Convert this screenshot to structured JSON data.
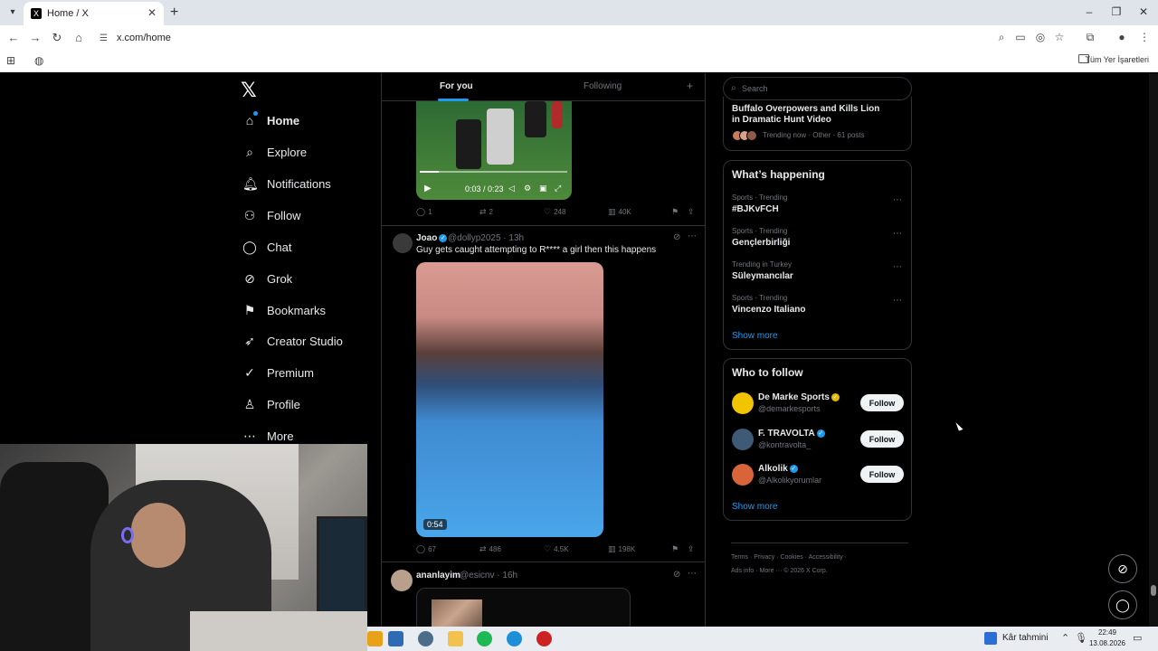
{
  "browser": {
    "tab_title": "Home / X",
    "tab_favicon": "X",
    "url": "x.com/home",
    "bookmarks_label": "Tüm Yer İşaretleri"
  },
  "logo": "𝕏",
  "nav": [
    {
      "label": "Home",
      "icon": "home-icon",
      "glyph": "⌂"
    },
    {
      "label": "Explore",
      "icon": "search-icon",
      "glyph": "⌕"
    },
    {
      "label": "Notifications",
      "icon": "bell-icon",
      "glyph": "🔔︎"
    },
    {
      "label": "Follow",
      "icon": "person-add-icon",
      "glyph": "⚇"
    },
    {
      "label": "Chat",
      "icon": "chat-icon",
      "glyph": "◯"
    },
    {
      "label": "Grok",
      "icon": "grok-icon",
      "glyph": "⊘"
    },
    {
      "label": "Bookmarks",
      "icon": "bookmark-icon",
      "glyph": "⚑"
    },
    {
      "label": "Creator Studio",
      "icon": "rocket-icon",
      "glyph": "➶"
    },
    {
      "label": "Premium",
      "icon": "verified-icon",
      "glyph": "✓"
    },
    {
      "label": "Profile",
      "icon": "person-icon",
      "glyph": "♙"
    },
    {
      "label": "More",
      "icon": "more-circle-icon",
      "glyph": "⋯"
    }
  ],
  "feed": {
    "tabs": [
      "For you",
      "Following"
    ],
    "post1": {
      "video_time": "0:03 / 0:23",
      "video_progress": 0.13,
      "replies": "1",
      "reposts": "2",
      "likes": "248",
      "views": "40K"
    },
    "post2": {
      "name": "Joao",
      "handle": "@dollyp2025 · 13h",
      "text": "Guy gets caught attempting to R**** a girl then this happens",
      "duration": "0:54",
      "replies": "67",
      "reposts": "486",
      "likes": "4.5K",
      "views": "198K"
    },
    "post3": {
      "name": "ananlayim",
      "handle": "@esicnv · 16h"
    }
  },
  "right": {
    "search_placeholder": "Search",
    "top_trend": {
      "title": "Buffalo Overpowers and Kills Lion in Dramatic Hunt Video",
      "meta": "Trending now · Other · 61 posts"
    },
    "happening_title": "What’s happening",
    "trends": [
      {
        "category": "Sports · Trending",
        "name": "#BJKvFCH"
      },
      {
        "category": "Sports · Trending",
        "name": "Gençlerbirliği"
      },
      {
        "category": "Trending in Turkey",
        "name": "Süleymancılar"
      },
      {
        "category": "Sports · Trending",
        "name": "Vincenzo Italiano"
      }
    ],
    "show_more": "Show more",
    "wtf_title": "Who to follow",
    "who_to_follow": [
      {
        "name": "De Marke Sports",
        "handle": "@demarkesports",
        "button": "Follow",
        "avatar_color": "#f2c400"
      },
      {
        "name": "F. TRAVOLTA",
        "handle": "@kontravolta_",
        "button": "Follow",
        "avatar_color": "#3f5a76"
      },
      {
        "name": "Alkolik",
        "handle": "@Alkolikyorumlar",
        "button": "Follow",
        "avatar_color": "#d9643a"
      }
    ],
    "footer_line1": "Terms · Privacy · Cookies · Accessibility ·",
    "footer_line2": "Ads info · More ··· © 2026 X Corp."
  },
  "taskbar": {
    "weather": "Kâr tahmini",
    "time": "22:49",
    "date": "13.08.2026"
  },
  "colors": {
    "accent": "#1d9bf0",
    "background": "#000000",
    "border": "#2f3336"
  }
}
